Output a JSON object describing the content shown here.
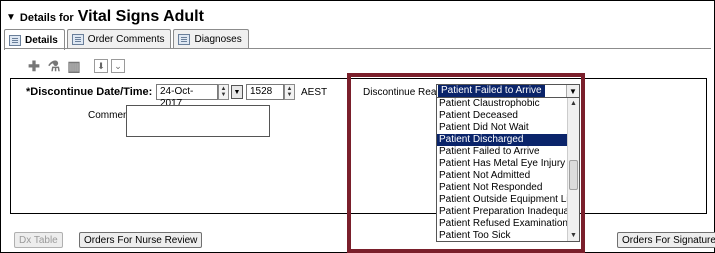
{
  "title": {
    "prefix": "Details for",
    "name": "Vital Signs Adult"
  },
  "tabs": [
    {
      "label": "Details",
      "icon": "details-icon"
    },
    {
      "label": "Order Comments",
      "icon": "comments-icon"
    },
    {
      "label": "Diagnoses",
      "icon": "diagnoses-icon"
    }
  ],
  "form": {
    "discontinue_label": "*Discontinue Date/Time:",
    "date_value": "24-Oct-2017",
    "time_value": "1528",
    "timezone": "AEST",
    "comments_label": "Comments:",
    "reason_label": "Discontinue Reason:",
    "reason_selected": "Patient Failed to Arrive"
  },
  "reason_options": [
    "Patient Claustrophobic",
    "Patient Deceased",
    "Patient Did Not Wait",
    "Patient Discharged",
    "Patient Failed to Arrive",
    "Patient Has Metal Eye Injury",
    "Patient Not Admitted",
    "Patient Not Responded",
    "Patient Outside Equipment Limit",
    "Patient Preparation Inadequate",
    "Patient Refused Examination",
    "Patient Too Sick"
  ],
  "highlighted_option": "Patient Discharged",
  "buttons": {
    "dx_table": "Dx Table",
    "orders_review": "Orders For Nurse Review",
    "orders_signature": "Orders For Signature"
  },
  "colors": {
    "selection": "#0a246a",
    "highlight_border": "#7a1f2b"
  }
}
